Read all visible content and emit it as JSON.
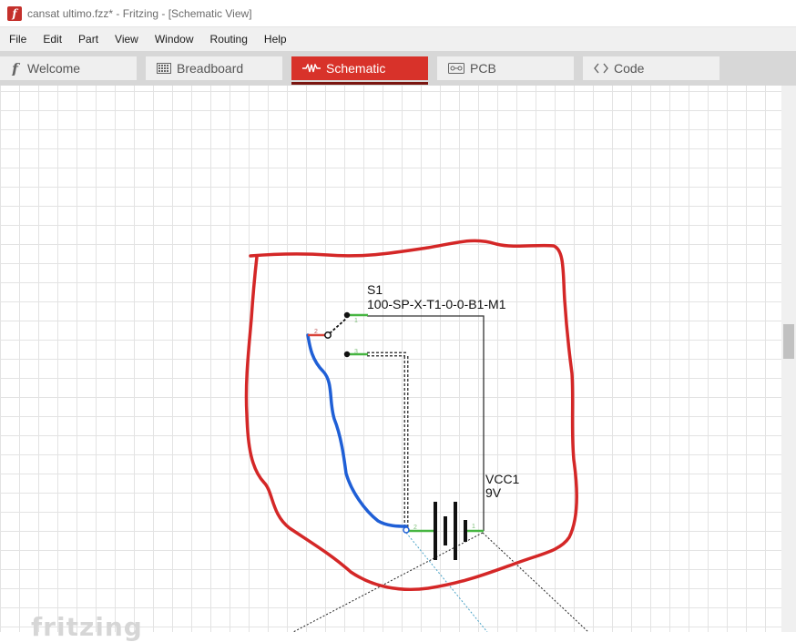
{
  "window": {
    "title": "cansat ultimo.fzz* - Fritzing - [Schematic View]"
  },
  "menu": [
    "File",
    "Edit",
    "Part",
    "View",
    "Window",
    "Routing",
    "Help"
  ],
  "tabs": [
    {
      "label": "Welcome",
      "icon": "fritzing-f-icon",
      "active": false
    },
    {
      "label": "Breadboard",
      "icon": "breadboard-icon",
      "active": false
    },
    {
      "label": "Schematic",
      "icon": "resistor-icon",
      "active": true
    },
    {
      "label": "PCB",
      "icon": "pcb-icon",
      "active": false
    },
    {
      "label": "Code",
      "icon": "code-brackets-icon",
      "active": false
    }
  ],
  "schematic": {
    "switch": {
      "ref": "S1",
      "part": "100-SP-X-T1-0-0-B1-M1",
      "pins": [
        "1",
        "2",
        "3"
      ]
    },
    "battery": {
      "ref": "VCC1",
      "value": "9V",
      "pins": [
        "2",
        "1"
      ]
    }
  },
  "watermark": "fritzing",
  "colors": {
    "accent_tab": "#d8322a",
    "annotation_red": "#d42727",
    "wire_blue": "#1f5fd6",
    "pin_green": "#46b541"
  }
}
